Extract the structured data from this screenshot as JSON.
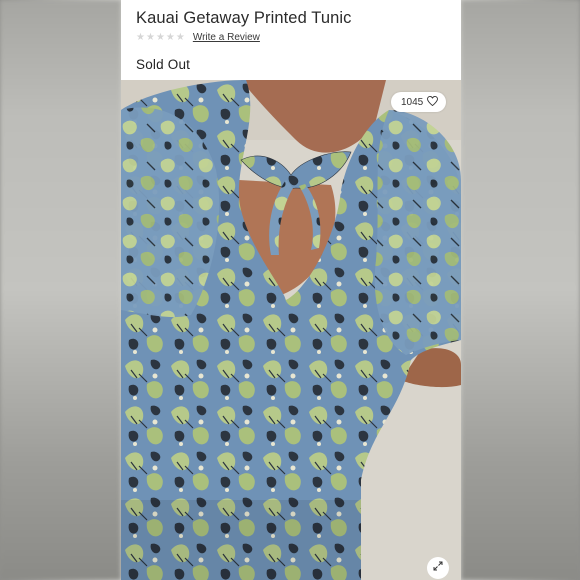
{
  "product": {
    "title": "Kauai Getaway Printed Tunic",
    "rating_stars": 5,
    "rating_value": 0,
    "review_link": "Write a Review",
    "status": "Sold Out"
  },
  "image": {
    "likes": "1045",
    "like_icon": "heart-outline-icon",
    "expand_icon": "expand-arrows-icon",
    "alt_subject": "model wearing blue floral tunic with tie back"
  },
  "colors": {
    "fabric_blue": "#6f92b6",
    "fabric_green": "#b6c98a",
    "print_dark": "#2c3540",
    "skin": "#a56c52",
    "background": "#d9d5cc"
  }
}
